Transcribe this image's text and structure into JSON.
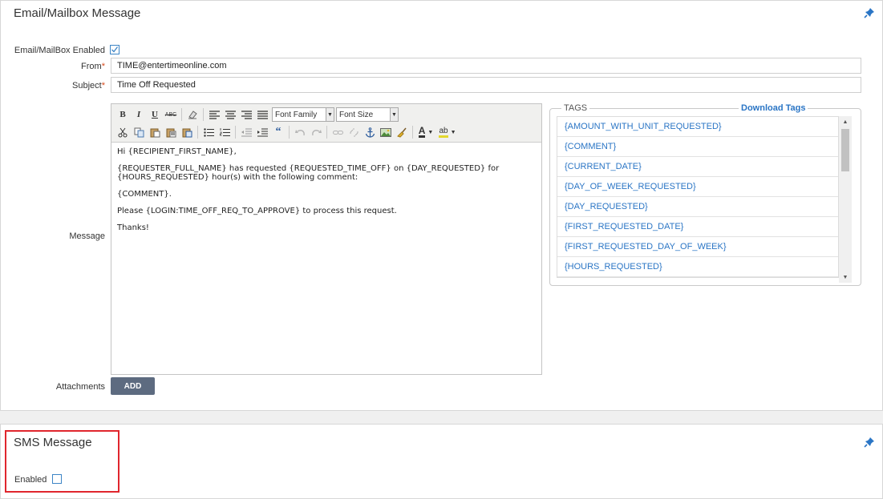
{
  "email": {
    "title": "Email/Mailbox Message",
    "enabled_label": "Email/MailBox Enabled",
    "enabled_checked": true,
    "from_label": "From",
    "from_value": "TIME@entertimeonline.com",
    "subject_label": "Subject",
    "subject_value": "Time Off Requested",
    "required_marker": "*",
    "message_label": "Message",
    "attachments_label": "Attachments",
    "add_button": "ADD"
  },
  "editor": {
    "toolbar": {
      "bold": "B",
      "italic": "I",
      "underline": "U",
      "strikethrough": "ABC",
      "font_family": "Font Family",
      "font_size": "Font Size",
      "text_color": "A",
      "highlight": "ab"
    },
    "body": [
      "Hi {RECIPIENT_FIRST_NAME},",
      "{REQUESTER_FULL_NAME} has requested {REQUESTED_TIME_OFF} on {DAY_REQUESTED} for {HOURS_REQUESTED} hour(s) with the following comment:",
      "{COMMENT}.",
      "Please {LOGIN:TIME_OFF_REQ_TO_APPROVE} to process this request.",
      "Thanks!"
    ]
  },
  "tags": {
    "legend": "TAGS",
    "download_label": "Download Tags",
    "items": [
      "{AMOUNT_WITH_UNIT_REQUESTED}",
      "{COMMENT}",
      "{CURRENT_DATE}",
      "{DAY_OF_WEEK_REQUESTED}",
      "{DAY_REQUESTED}",
      "{FIRST_REQUESTED_DATE}",
      "{FIRST_REQUESTED_DAY_OF_WEEK}",
      "{HOURS_REQUESTED}"
    ]
  },
  "sms": {
    "title": "SMS Message",
    "enabled_label": "Enabled",
    "enabled_checked": false
  },
  "colors": {
    "link": "#2a75c5",
    "required": "#d64a1c",
    "highlight_border": "#e0262d",
    "add_button_bg": "#5d6b80"
  }
}
